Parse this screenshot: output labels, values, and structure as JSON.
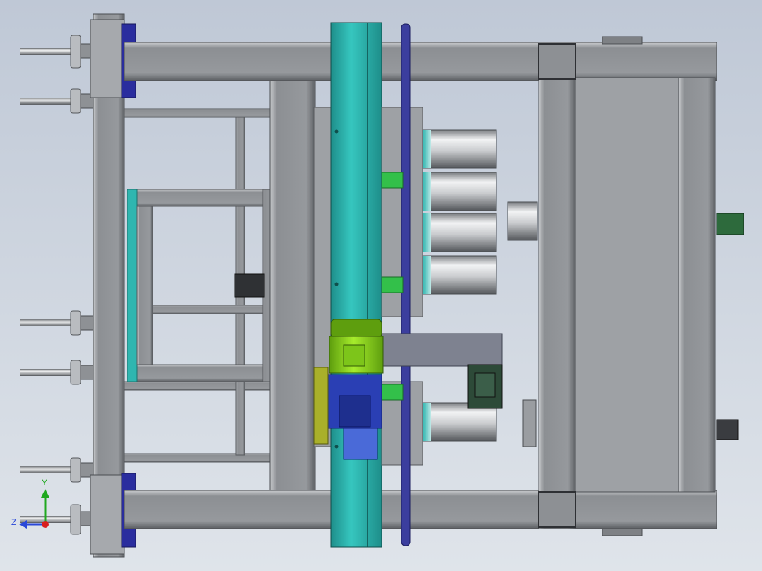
{
  "colors": {
    "background_top": "#c4ccd8",
    "background_bottom": "#dde3ea",
    "frame_steel": "#9b9ea3",
    "frame_dark": "#55585c",
    "teal_column": "#2fb6b0",
    "motor_green": "#8fd81e",
    "gearbox_blue": "#2a3fb4",
    "plate_purple": "#3b3e9e",
    "cylinder_light": "#e2e4e6",
    "cylinder_shadow": "#6f7275",
    "axis_y": "#1fa81f",
    "axis_z": "#2a48d8",
    "axis_origin": "#d81e1e"
  },
  "axes": {
    "y_label": "Y",
    "z_label": "Z"
  }
}
